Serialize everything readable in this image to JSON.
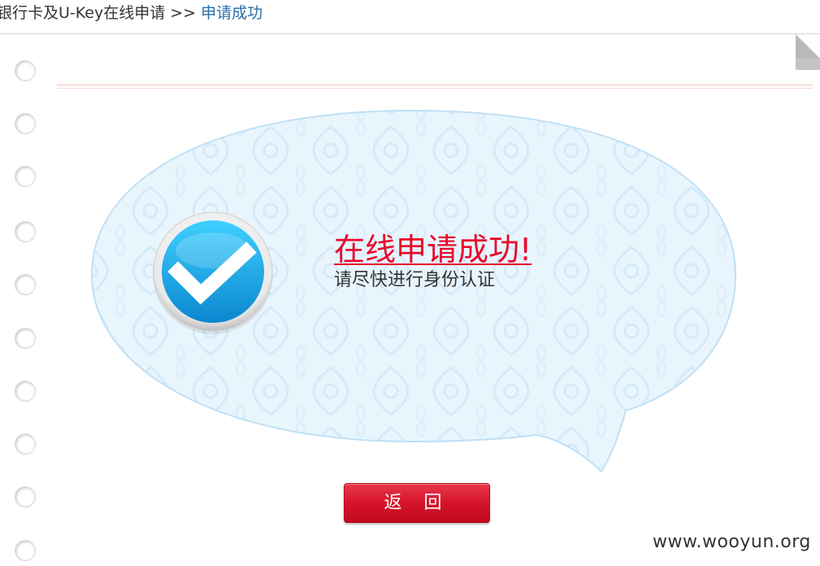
{
  "breadcrumb": {
    "parent": "银行卡及U-Key在线申请",
    "separator": ">>",
    "current": "申请成功"
  },
  "message": {
    "title": "在线申请成功!",
    "subtitle": "请尽快进行身份认证"
  },
  "actions": {
    "back_label": "返 回"
  },
  "watermark": "www.wooyun.org",
  "icons": {
    "success": "check-circle-icon",
    "binder_hole": "binder-hole-icon",
    "page_fold": "page-fold-icon"
  },
  "colors": {
    "title_red": "#e8082b",
    "button_red": "#d5142a",
    "bubble_fill": "#e8f4fc",
    "bubble_border": "#bfe0f5",
    "link_blue": "#2a6ea8",
    "check_blue": "#16a7e6"
  }
}
